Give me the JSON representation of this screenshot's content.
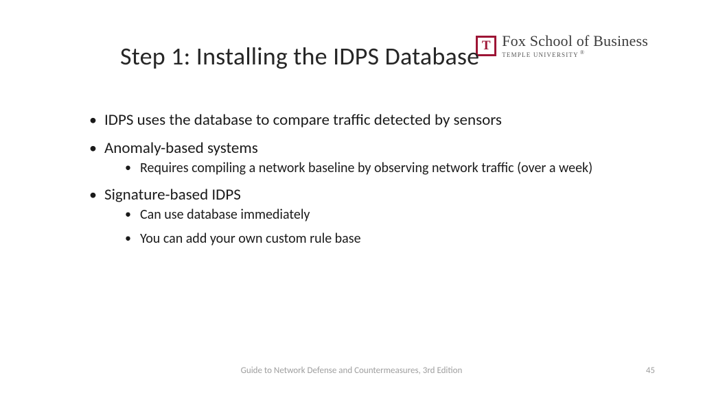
{
  "logo": {
    "mark": "T",
    "main": "Fox School of Business",
    "sub": "TEMPLE UNIVERSITY",
    "reg": "®"
  },
  "title": "Step 1: Installing the IDPS Database",
  "bullets": [
    {
      "text": "IDPS uses the database to compare traffic detected by sensors",
      "children": []
    },
    {
      "text": "Anomaly-based systems",
      "children": [
        "Requires compiling a network baseline by observing network traffic (over a week)"
      ]
    },
    {
      "text": "Signature-based IDPS",
      "children": [
        "Can use database immediately",
        "You can add your own custom rule base"
      ]
    }
  ],
  "footer": "Guide to Network Defense and Countermeasures, 3rd  Edition",
  "page": "45"
}
